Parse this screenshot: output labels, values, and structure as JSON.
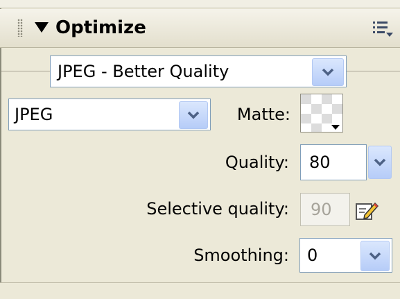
{
  "panel": {
    "title": "Optimize",
    "options_icon": "options-menu-icon",
    "collapse_icon": "triangle-down-icon"
  },
  "preset": {
    "value": "JPEG - Better Quality"
  },
  "format": {
    "value": "JPEG"
  },
  "matte": {
    "label": "Matte:",
    "icon": "matte-swatch-icon"
  },
  "quality": {
    "label": "Quality:",
    "value": "80"
  },
  "selective_quality": {
    "label": "Selective quality:",
    "value": "90",
    "edit_icon": "pencil-edit-icon"
  },
  "smoothing": {
    "label": "Smoothing:",
    "value": "0"
  },
  "colors": {
    "panel_bg": "#ECE9D8",
    "field_border": "#7F9DB9",
    "dropdown_button": "#B6CCF8",
    "chevron": "#4D6185"
  }
}
